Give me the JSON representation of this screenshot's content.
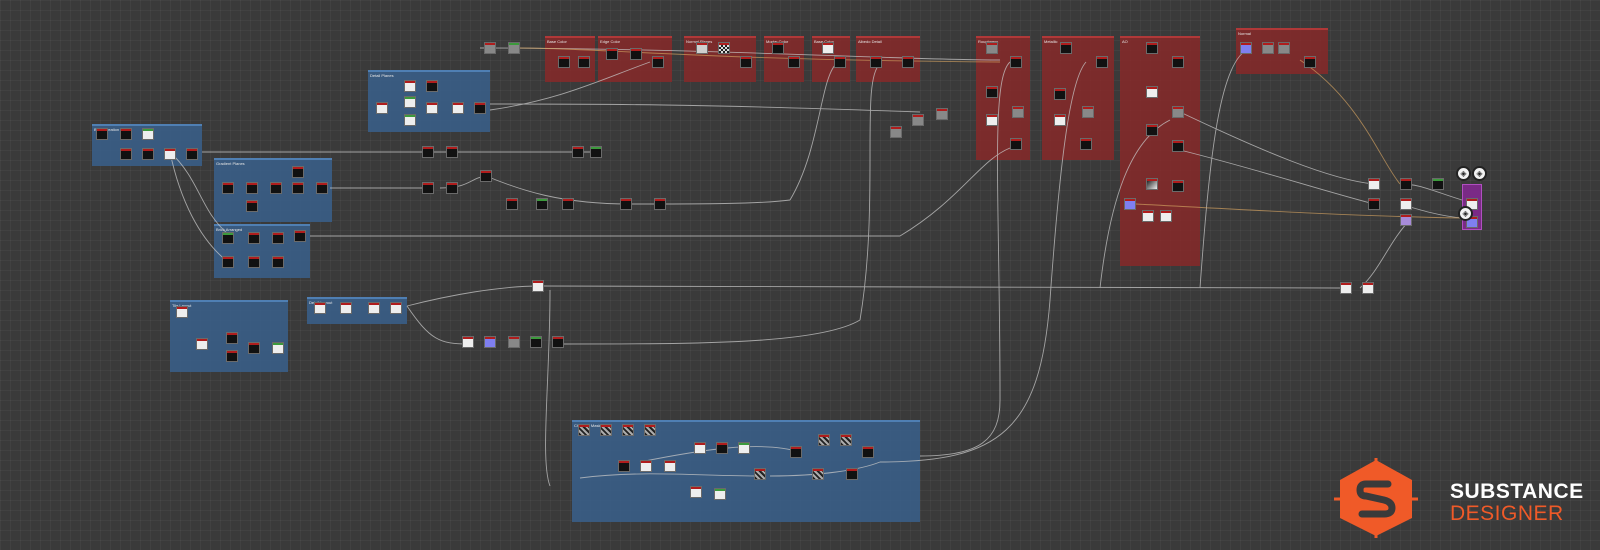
{
  "app": {
    "logo_line1": "SUBSTANCE",
    "logo_line2": "DESIGNER",
    "logo_icon": "substance-s-cube-icon",
    "accent_color": "#f05a28"
  },
  "frames": [
    {
      "id": "f1",
      "title": "Brick Creation",
      "color": "blue"
    },
    {
      "id": "f2",
      "title": "Detail Planes",
      "color": "blue"
    },
    {
      "id": "f3",
      "title": "Brick Arranged",
      "color": "blue"
    },
    {
      "id": "f4",
      "title": "Gradient Planes",
      "color": "blue"
    },
    {
      "id": "f5",
      "title": "Tile Layout",
      "color": "blue"
    },
    {
      "id": "f6",
      "title": "Detail Layout",
      "color": "blue"
    },
    {
      "id": "f7",
      "title": "Chipping Mask",
      "color": "blue"
    },
    {
      "id": "f8",
      "title": "Base Color",
      "color": "red"
    },
    {
      "id": "f9",
      "title": "Edge Color",
      "color": "red"
    },
    {
      "id": "f10",
      "title": "Normal Planes",
      "color": "red"
    },
    {
      "id": "f11",
      "title": "Mortar Color",
      "color": "red"
    },
    {
      "id": "f12",
      "title": "Base Color",
      "color": "red"
    },
    {
      "id": "f13",
      "title": "Albedo Detail",
      "color": "red"
    },
    {
      "id": "f14",
      "title": "Roughness",
      "color": "red"
    },
    {
      "id": "f15",
      "title": "Metallic",
      "color": "red"
    },
    {
      "id": "f16",
      "title": "AO",
      "color": "red"
    },
    {
      "id": "f17",
      "title": "Normal",
      "color": "red"
    }
  ],
  "output_icons": [
    "output-cube-icon",
    "output-cube-icon",
    "output-cube-icon"
  ]
}
